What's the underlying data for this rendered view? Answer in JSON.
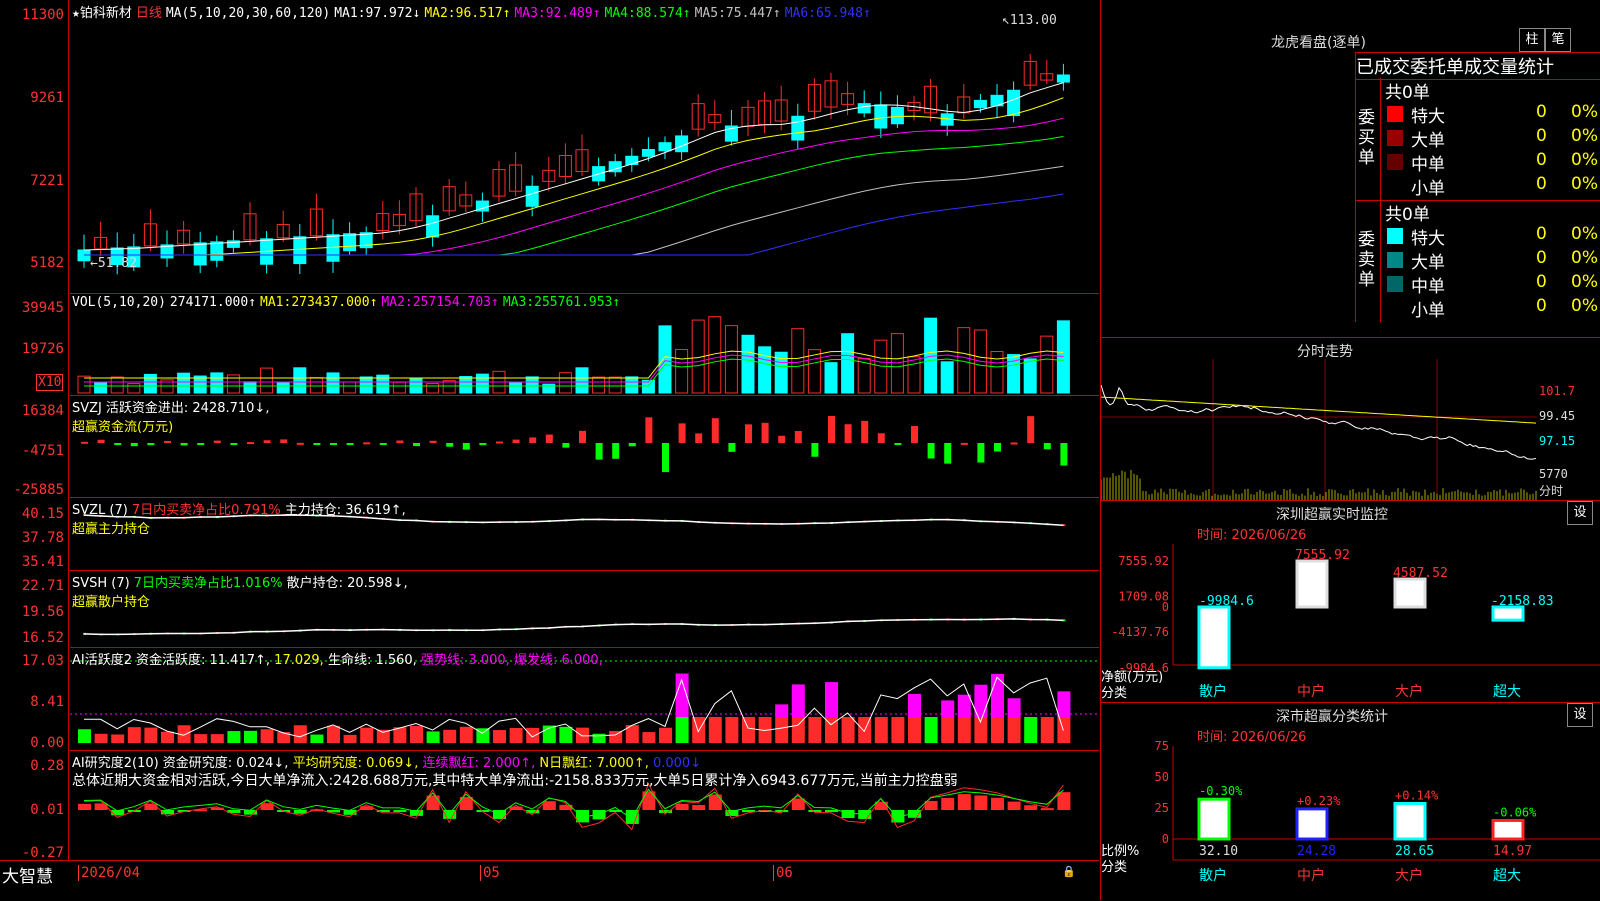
{
  "colors": {
    "up": "#ff2a2a",
    "down": "#00ffff",
    "bg": "#000000",
    "axis": "#cc0000",
    "ma1": "#ffffff",
    "ma2": "#ffff00",
    "ma3": "#ff00ff",
    "ma4": "#00ff00",
    "ma5": "#c0c0c0",
    "ma6": "#3030ff"
  },
  "price_panel": {
    "star_icon": "★",
    "stock": "铂科新材",
    "period": "日线",
    "ma_params": "MA(5,10,20,30,60,120)",
    "ma_items": [
      {
        "label": "MA1:",
        "value": "97.972↓",
        "color": "#ffffff"
      },
      {
        "label": "MA2:",
        "value": "96.517↑",
        "color": "#ffff00"
      },
      {
        "label": "MA3:",
        "value": "92.489↑",
        "color": "#ff00ff"
      },
      {
        "label": "MA4:",
        "value": "88.574↑",
        "color": "#00ff00"
      },
      {
        "label": "MA5:",
        "value": "75.447↑",
        "color": "#c0c0c0"
      },
      {
        "label": "MA6:",
        "value": "65.948↑",
        "color": "#3030ff"
      }
    ],
    "y_ticks": [
      "11300",
      "9261",
      "7221",
      "5182"
    ],
    "high_mark": "113.00",
    "low_mark": "51.82"
  },
  "vol_panel": {
    "title": "VOL(5,10,20)",
    "value": "274171.000↑",
    "ma": [
      {
        "label": "MA1:",
        "value": "273437.000↑",
        "color": "#ffff00"
      },
      {
        "label": "MA2:",
        "value": "257154.703↑",
        "color": "#ff00ff"
      },
      {
        "label": "MA3:",
        "value": "255761.953↑",
        "color": "#00ff00"
      }
    ],
    "y_ticks": [
      "39945",
      "19726"
    ],
    "unit": "X10"
  },
  "svzj_panel": {
    "title": "SVZJ",
    "line1": "活跃资金进出: 2428.710↓,",
    "line2": "超赢资金流(万元)",
    "y_ticks": [
      "16384",
      "-4751",
      "-25885"
    ]
  },
  "svzl_panel": {
    "title": "SVZL (7)",
    "pct": "7日内买卖净占比0.791%",
    "label": "主力持仓: 36.619↑,",
    "line2": "超赢主力持仓",
    "y_ticks": [
      "40.15",
      "37.78",
      "35.41"
    ]
  },
  "svsh_panel": {
    "title": "SVSH (7)",
    "pct": "7日内买卖净占比1.016%",
    "label": "散户持仓: 20.598↓,",
    "line2": "超赢散户持仓",
    "y_ticks": [
      "22.71",
      "19.56",
      "16.52"
    ]
  },
  "ai1_panel": {
    "title": "AI活跃度2",
    "items": [
      {
        "t": "资金活跃度: 11.417↑, ",
        "c": "#ffffff"
      },
      {
        "t": "17.029, ",
        "c": "#ffff00"
      },
      {
        "t": "生命线: 1.560, ",
        "c": "#ffffff"
      },
      {
        "t": "强势线: 3.000, ",
        "c": "#ff00ff"
      },
      {
        "t": "爆发线: 6.000,",
        "c": "#ff00ff"
      }
    ],
    "y_ticks": [
      "17.03",
      "8.41",
      "0.00"
    ]
  },
  "ai2_panel": {
    "title": "AI研究度2(10)",
    "items": [
      {
        "t": "资金研究度: 0.024↓, ",
        "c": "#ffffff"
      },
      {
        "t": "平均研究度: 0.069↓, ",
        "c": "#ffff00"
      },
      {
        "t": "连续飘红: 2.000↑, ",
        "c": "#ff00ff"
      },
      {
        "t": "N日飘红: 7.000↑, ",
        "c": "#ffff00"
      },
      {
        "t": "0.000↓",
        "c": "#3030ff"
      }
    ],
    "summary": "总体近期大资金相对活跃,今日大单净流入:2428.688万元,其中特大单净流出:-2158.833万元,大单5日累计净入6943.677万元,当前主力控盘弱",
    "y_ticks": [
      "0.28",
      "0.01",
      "-0.27"
    ]
  },
  "x_axis": {
    "brand": "大智慧",
    "labels": [
      "2026/04",
      "05",
      "06"
    ]
  },
  "dragon": {
    "title": "龙虎看盘(逐单)",
    "btn_bar": "柱",
    "btn_pen": "笔",
    "tabs": "已成交委托单成交量统计",
    "buy_label": "委买单",
    "sell_label": "委卖单",
    "buy_total": "共0单",
    "sell_total": "共0单",
    "buy_rows": [
      {
        "label": "特大",
        "value": "0",
        "pct": "0%",
        "color": "#ff0000"
      },
      {
        "label": "大单",
        "value": "0",
        "pct": "0%",
        "color": "#990000"
      },
      {
        "label": "中单",
        "value": "0",
        "pct": "0%",
        "color": "#660000"
      },
      {
        "label": "小单",
        "value": "0",
        "pct": "0%",
        "color": ""
      }
    ],
    "sell_rows": [
      {
        "label": "特大",
        "value": "0",
        "pct": "0%",
        "color": "#00ffff"
      },
      {
        "label": "大单",
        "value": "0",
        "pct": "0%",
        "color": "#008888"
      },
      {
        "label": "中单",
        "value": "0",
        "pct": "0%",
        "color": "#006666"
      },
      {
        "label": "小单",
        "value": "0",
        "pct": "0%",
        "color": ""
      }
    ]
  },
  "intraday": {
    "title": "分时走势",
    "price_ticks": [
      "101.7",
      "99.45",
      "97.15"
    ],
    "vol_tick": "5770",
    "vol_unit": "分时"
  },
  "monitor": {
    "title": "深圳超赢实时监控",
    "set": "设",
    "time": "时间: 2026/06/26",
    "y_ticks": [
      "7555.92",
      "1709.08",
      "0",
      "-4137.76",
      "-9984.6"
    ],
    "bar_labels": [
      "-9984.6",
      "7555.92",
      "4587.52",
      "-2158.83"
    ],
    "values": [
      -9984.6,
      7555.92,
      4587.52,
      -2158.83
    ],
    "categories": [
      "散户",
      "中户",
      "大户",
      "超大"
    ],
    "y_title": "净额(万元)",
    "x_title": "分类"
  },
  "stats": {
    "title": "深市超赢分类统计",
    "set": "设",
    "time": "时间: 2026/06/26",
    "y_ticks": [
      "75",
      "50",
      "25",
      "0"
    ],
    "pct_labels": [
      "-0.30%",
      "+0.23%",
      "+0.14%",
      "-0.06%"
    ],
    "values": [
      32.1,
      24.28,
      28.65,
      14.97
    ],
    "value_labels": [
      "32.10",
      "24.28",
      "28.65",
      "14.97"
    ],
    "categories": [
      "散户",
      "中户",
      "大户",
      "超大"
    ],
    "y_title": "比例%",
    "x_title": "分类"
  }
}
